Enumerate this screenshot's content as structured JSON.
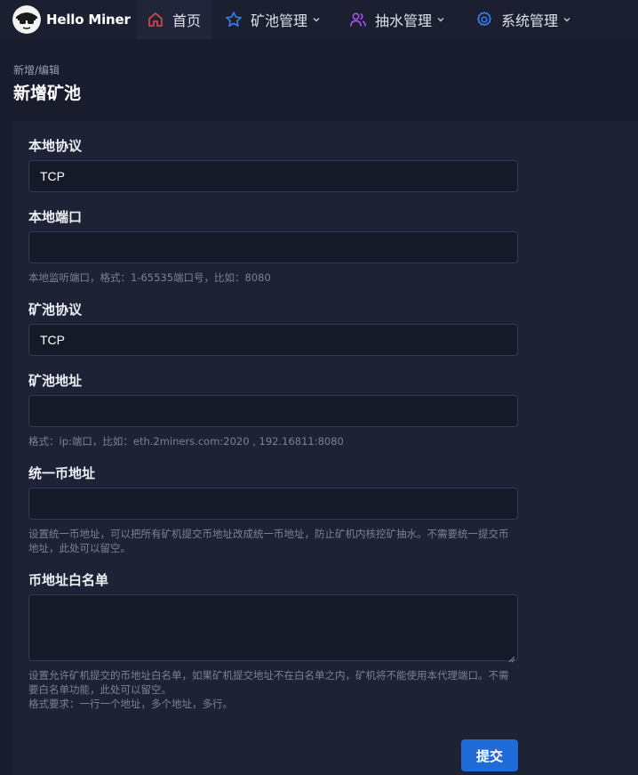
{
  "app": {
    "name": "Hello Miner"
  },
  "nav": {
    "home": "首页",
    "pool_mgmt": "矿池管理",
    "pump_mgmt": "抽水管理",
    "sys_mgmt": "系统管理"
  },
  "colors": {
    "accent": "#1f6bd8",
    "home_icon": "#e5484d",
    "star_icon": "#3b82f6",
    "users_icon": "#a855f7",
    "gear_icon": "#3b82f6"
  },
  "page": {
    "breadcrumb": "新增/编辑",
    "title": "新增矿池"
  },
  "form": {
    "local_protocol": {
      "label": "本地协议",
      "value": "TCP"
    },
    "local_port": {
      "label": "本地端口",
      "value": "",
      "help": "本地监听端口，格式：1-65535端口号，比如：8080"
    },
    "pool_protocol": {
      "label": "矿池协议",
      "value": "TCP"
    },
    "pool_address": {
      "label": "矿池地址",
      "value": "",
      "help": "格式：ip:端口，比如：eth.2miners.com:2020 , 192.16811:8080"
    },
    "unified_address": {
      "label": "统一币地址",
      "value": "",
      "help": "设置统一币地址，可以把所有矿机提交币地址改成统一币地址，防止矿机内核挖矿抽水。不需要统一提交币地址，此处可以留空。"
    },
    "whitelist": {
      "label": "币地址白名单",
      "value": "",
      "help_line1": "设置允许矿机提交的币地址白名单，如果矿机提交地址不在白名单之内，矿机将不能使用本代理端口。不需要白名单功能，此处可以留空。",
      "help_line2": "格式要求：一行一个地址，多个地址，多行。"
    },
    "submit_label": "提交"
  }
}
